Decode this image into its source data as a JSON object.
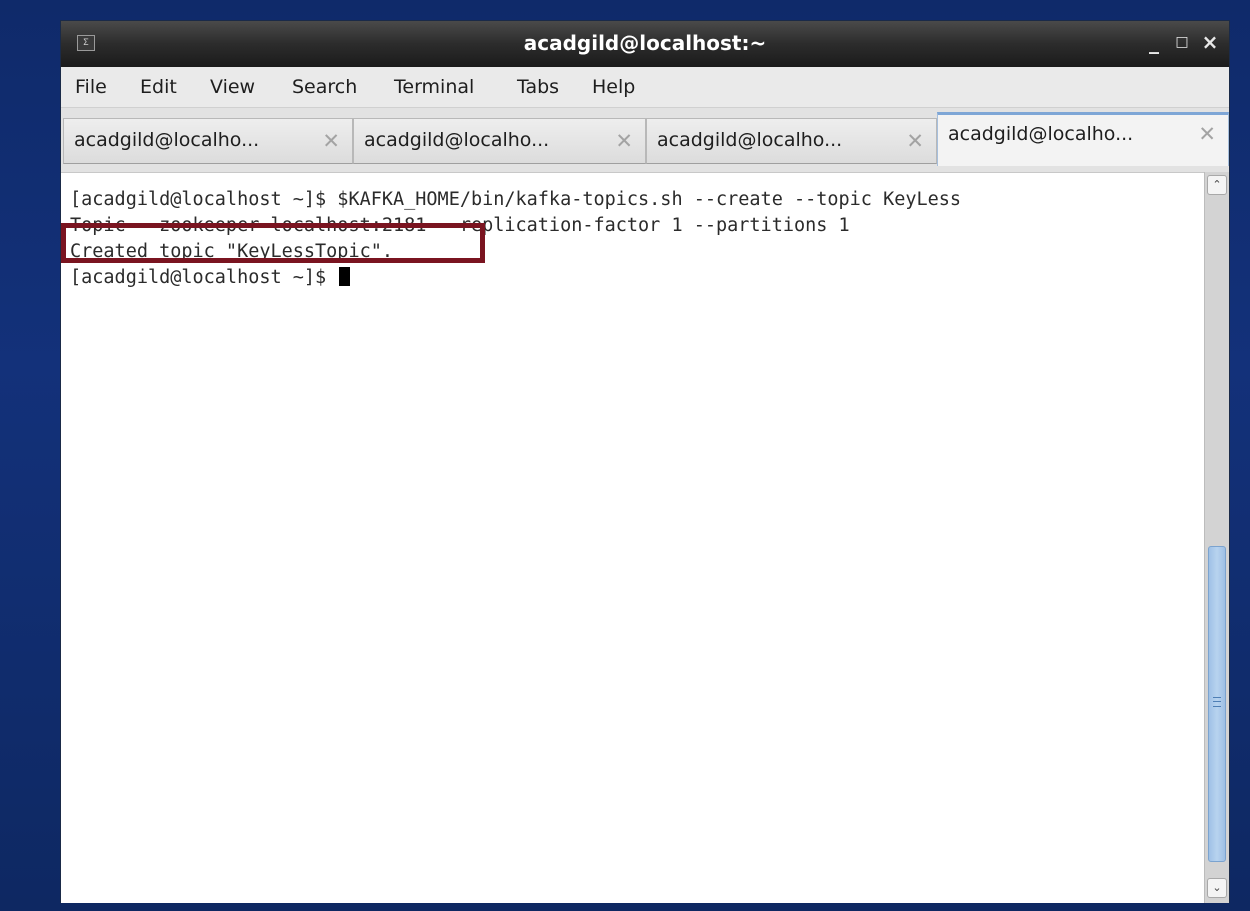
{
  "window": {
    "title": "acadgild@localhost:~",
    "minimize_glyph": "_",
    "maximize_glyph": "□",
    "close_glyph": "×",
    "terminal_icon_glyph": "Σ"
  },
  "menubar": {
    "items": [
      {
        "label": "File"
      },
      {
        "label": "Edit"
      },
      {
        "label": "View"
      },
      {
        "label": "Search"
      },
      {
        "label": "Terminal"
      },
      {
        "label": "Tabs"
      },
      {
        "label": "Help"
      }
    ]
  },
  "tabs": [
    {
      "label": "acadgild@localho...",
      "active": false,
      "close_glyph": "✕"
    },
    {
      "label": "acadgild@localho...",
      "active": false,
      "close_glyph": "✕"
    },
    {
      "label": "acadgild@localho...",
      "active": false,
      "close_glyph": "✕"
    },
    {
      "label": "acadgild@localho...",
      "active": true,
      "close_glyph": "✕"
    }
  ],
  "terminal": {
    "lines": [
      "[acadgild@localhost ~]$ $KAFKA_HOME/bin/kafka-topics.sh --create --topic KeyLess",
      "Topic --zookeeper localhost:2181 --replication-factor 1 --partitions 1",
      "Created topic \"KeyLessTopic\".",
      "[acadgild@localhost ~]$ "
    ]
  },
  "scrollbar": {
    "up_glyph": "⌃",
    "down_glyph": "⌄"
  },
  "colors": {
    "desktop_background": "#13317a",
    "highlight_box": "#7a1420",
    "scroll_thumb": "#9fc1e6",
    "active_tab_accent": "#7ea6d6"
  },
  "icons": [
    "terminal-icon",
    "minimize-icon",
    "maximize-icon",
    "close-icon",
    "tab-close-icon",
    "scroll-up-arrow-icon",
    "scroll-down-arrow-icon"
  ]
}
